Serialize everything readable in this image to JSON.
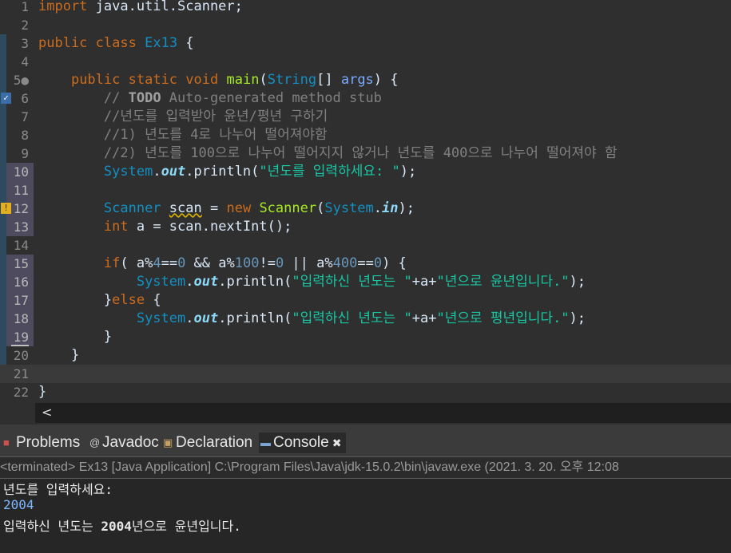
{
  "editor": {
    "lines": [
      {
        "n": "1",
        "html": "<span class=\"kw\">import</span> java.util.Scanner;"
      },
      {
        "n": "2",
        "html": ""
      },
      {
        "n": "3",
        "html": "<span class=\"kw\">public</span> <span class=\"kw\">class</span> <span class=\"cls\">Ex13</span> {"
      },
      {
        "n": "4",
        "html": ""
      },
      {
        "n": "5●",
        "html": "    <span class=\"kw\">public</span> <span class=\"kw\">static</span> <span class=\"kw\">void</span> <span class=\"meth\">main</span>(<span class=\"cls\">String</span>[] <span class=\"var\">args</span>) {"
      },
      {
        "n": "6",
        "html": "        <span class=\"cmt\">// <span class=\"todo\">TODO</span> Auto-generated method stub</span>"
      },
      {
        "n": "7",
        "html": "        <span class=\"cmt\">//년도를 입력받아 윤년/평년 구하기</span>"
      },
      {
        "n": "8",
        "html": "        <span class=\"cmt\">//1) 년도를 4로 나누어 떨어져야함</span>"
      },
      {
        "n": "9",
        "html": "        <span class=\"cmt\">//2) 년도를 100으로 나누어 떨어지지 않거나 년도를 400으로 나누어 떨어져야 함</span>"
      },
      {
        "n": "10",
        "html": "        <span class=\"cls\">System</span>.<span class=\"fld\">out</span>.println(<span class=\"str\">\"년도를 입력하세요: \"</span>);"
      },
      {
        "n": "11",
        "html": ""
      },
      {
        "n": "12",
        "html": "        <span class=\"cls\">Scanner</span> <span class=\"wavy\">scan</span> = <span class=\"kw\">new</span> <span class=\"meth\">Scanner</span>(<span class=\"cls\">System</span>.<span class=\"fld\">in</span>);"
      },
      {
        "n": "13",
        "html": "        <span class=\"kw\">int</span> a = scan.nextInt();"
      },
      {
        "n": "14",
        "html": ""
      },
      {
        "n": "15",
        "html": "        <span class=\"kw\">if</span>( a%<span class=\"num\">4</span>==<span class=\"num\">0</span> &amp;&amp; a%<span class=\"num\">100</span>!=<span class=\"num\">0</span> || a%<span class=\"num\">400</span>==<span class=\"num\">0</span>) {"
      },
      {
        "n": "16",
        "html": "            <span class=\"cls\">System</span>.<span class=\"fld\">out</span>.println(<span class=\"str\">\"입력하신 년도는 \"</span>+a+<span class=\"str\">\"년으로 윤년입니다.\"</span>);"
      },
      {
        "n": "17",
        "html": "        }<span class=\"kw\">else</span> {"
      },
      {
        "n": "18",
        "html": "            <span class=\"cls\">System</span>.<span class=\"fld\">out</span>.println(<span class=\"str\">\"입력하신 년도는 \"</span>+a+<span class=\"str\">\"년으로 평년입니다.\"</span>);"
      },
      {
        "n": "19",
        "html": "        }"
      },
      {
        "n": "20",
        "html": "    }"
      },
      {
        "n": "21",
        "html": ""
      },
      {
        "n": "22",
        "html": "}"
      }
    ],
    "scroll_left_arrow": "<"
  },
  "panel": {
    "tabs": {
      "problems": "Problems",
      "javadoc": "Javadoc",
      "declaration": "Declaration",
      "console": "Console",
      "close": "✖"
    },
    "status": "<terminated> Ex13 [Java Application] C:\\Program Files\\Java\\jdk-15.0.2\\bin\\javaw.exe  (2021. 3. 20. 오후 12:08",
    "output": {
      "prompt": "년도를 입력하세요: ",
      "input": "2004",
      "result_prefix": "입력하신 년도는 ",
      "result_year": "2004",
      "result_suffix": "년으로 윤년입니다."
    }
  }
}
